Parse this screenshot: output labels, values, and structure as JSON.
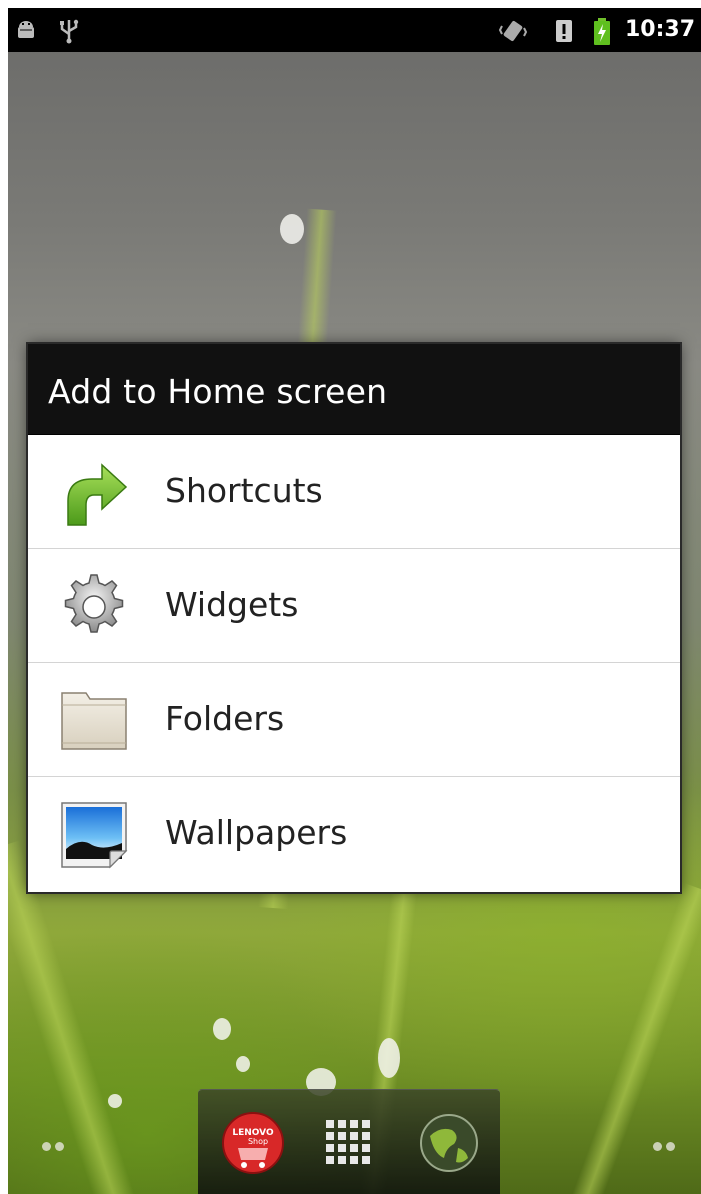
{
  "status_bar": {
    "left_icons": [
      "android-debug-icon",
      "usb-icon"
    ],
    "right_icons": [
      "vibrate-icon",
      "alert-icon",
      "battery-charging-icon"
    ],
    "time": "10:37"
  },
  "dialog": {
    "title": "Add to Home screen",
    "items": [
      {
        "label": "Shortcuts",
        "icon": "shortcut-arrow-icon"
      },
      {
        "label": "Widgets",
        "icon": "gear-icon"
      },
      {
        "label": "Folders",
        "icon": "folder-icon"
      },
      {
        "label": "Wallpapers",
        "icon": "wallpaper-icon"
      }
    ]
  },
  "dock": {
    "left_app": {
      "label": "LENOVO Shop",
      "icon": "lenovo-shop-icon"
    },
    "center": {
      "icon": "app-drawer-grid-icon"
    },
    "right_app": {
      "icon": "browser-globe-icon"
    }
  },
  "colors": {
    "status_bar_bg": "#000000",
    "dialog_header_bg": "#111111",
    "dialog_body_bg": "#ffffff",
    "accent_green": "#6aa82a"
  }
}
